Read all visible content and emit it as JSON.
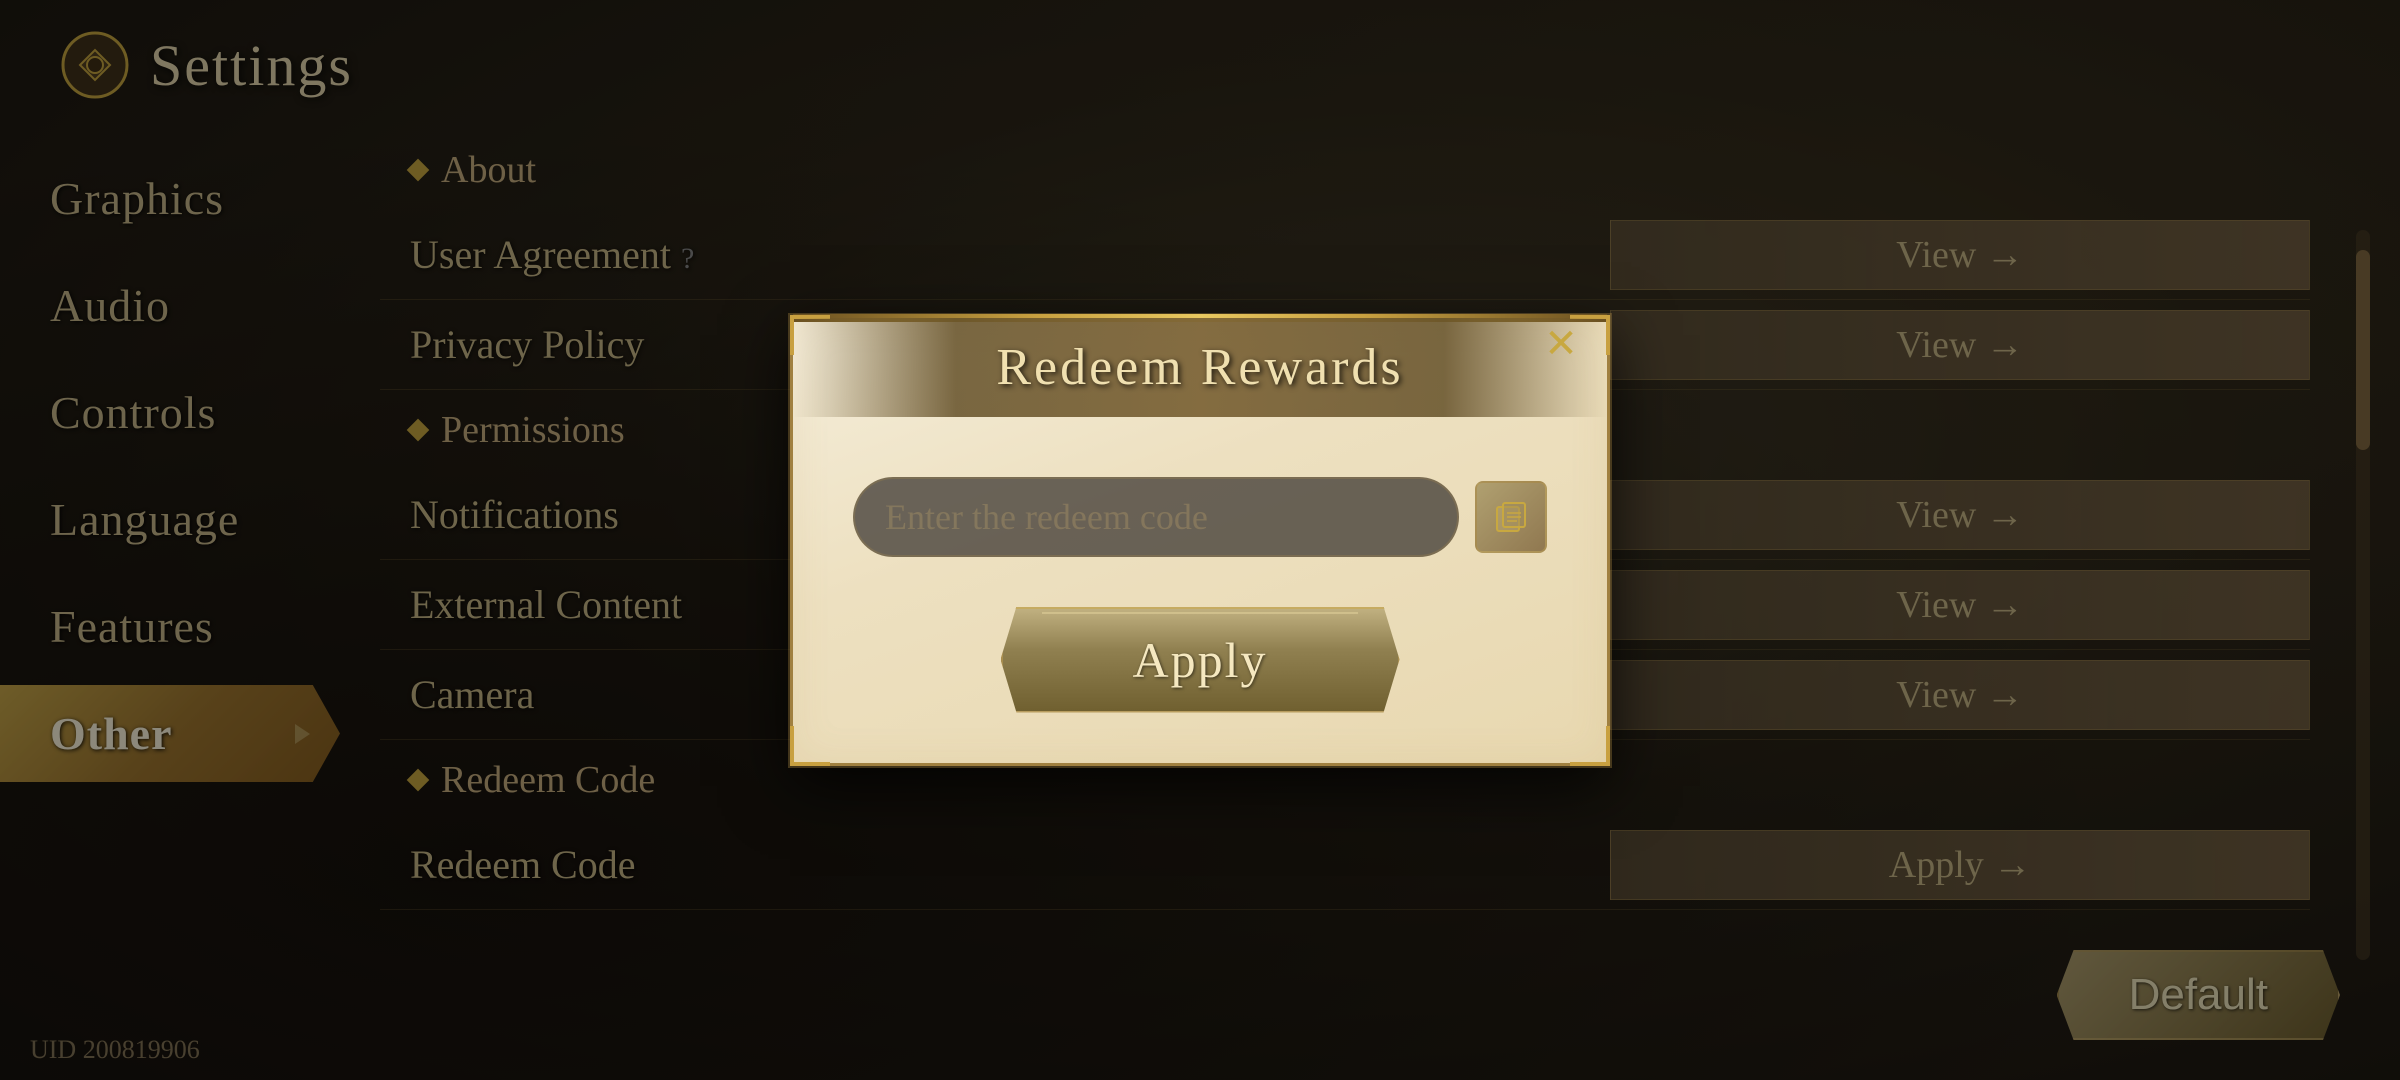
{
  "app": {
    "title": "Settings",
    "uid": "UID 200819906"
  },
  "sidebar": {
    "items": [
      {
        "id": "graphics",
        "label": "Graphics",
        "active": false
      },
      {
        "id": "audio",
        "label": "Audio",
        "active": false
      },
      {
        "id": "controls",
        "label": "Controls",
        "active": false
      },
      {
        "id": "language",
        "label": "Language",
        "active": false
      },
      {
        "id": "features",
        "label": "Features",
        "active": false
      },
      {
        "id": "other",
        "label": "Other",
        "active": true
      }
    ]
  },
  "main": {
    "section_about": "About",
    "rows": [
      {
        "id": "user-agreement",
        "label": "User Agreement",
        "action": "View →"
      },
      {
        "id": "privacy",
        "label": "Privacy Policy",
        "action": "View →"
      },
      {
        "id": "notifications",
        "label": "Notifications",
        "action": "View →"
      },
      {
        "id": "external",
        "label": "External Content",
        "action": "View →"
      },
      {
        "id": "camera",
        "label": "Camera",
        "action": "View →"
      },
      {
        "id": "redeem-code",
        "label": "Redeem Code",
        "action": "Apply →"
      }
    ],
    "section_permissions": "Permissions",
    "section_redeem": "Redeem Code"
  },
  "modal": {
    "title": "Redeem Rewards",
    "input_placeholder": "Enter the redeem code",
    "apply_label": "Apply",
    "close_label": "✕"
  },
  "footer": {
    "default_label": "Default"
  }
}
